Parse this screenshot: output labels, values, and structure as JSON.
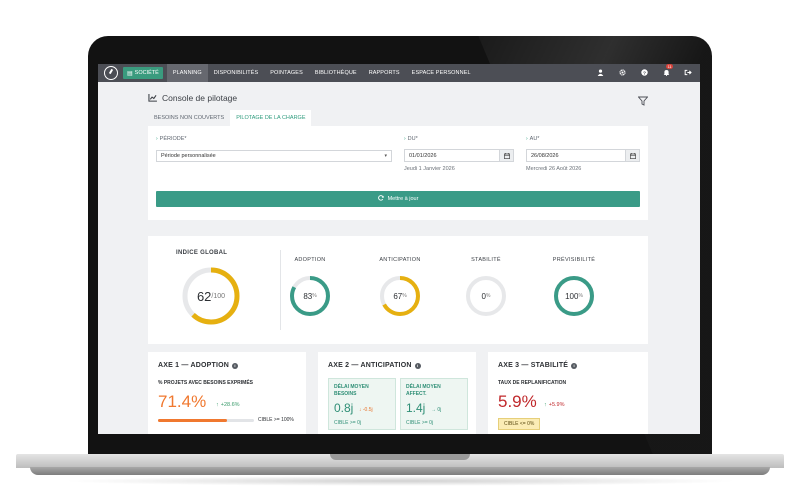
{
  "nav": {
    "societe": "SOCIÉTÉ",
    "items": [
      "PLANNING",
      "DISPONIBILITÉS",
      "POINTAGES",
      "BIBLIOTHÈQUE",
      "RAPPORTS",
      "ESPACE PERSONNEL"
    ],
    "active_index": 0,
    "notification_count": "11",
    "icons": [
      "user-icon",
      "gear-icon",
      "help-icon",
      "bell-icon",
      "logout-icon"
    ]
  },
  "page": {
    "title": "Console de pilotage",
    "title_icon": "chart-line-icon",
    "filter_icon": "filter-icon"
  },
  "tabs": [
    {
      "label": "BESOINS NON COUVERTS",
      "active": false
    },
    {
      "label": "PILOTAGE DE LA CHARGE",
      "active": true
    }
  ],
  "filters": {
    "periode_label": "PÉRIODE*",
    "periode_value": "Période personnalisée",
    "du_label": "DU*",
    "du_value": "01/01/2026",
    "du_hint": "Jeudi 1 Janvier 2026",
    "au_label": "AU*",
    "au_value": "26/08/2026",
    "au_hint": "Mercredi 26 Août 2026",
    "update_button": "Mettre à jour"
  },
  "kpis": {
    "global": {
      "label": "INDICE GLOBAL",
      "value": "62",
      "max": "/100",
      "ratio": 0.62,
      "color": "#e6b010"
    },
    "items": [
      {
        "label": "ADOPTION",
        "value": "83",
        "unit": "%",
        "ratio": 0.83,
        "color": "#3a9b87"
      },
      {
        "label": "ANTICIPATION",
        "value": "67",
        "unit": "%",
        "ratio": 0.67,
        "color": "#e6b010"
      },
      {
        "label": "STABILITÉ",
        "value": "0",
        "unit": "%",
        "ratio": 0.0,
        "color": "#3a9b87"
      },
      {
        "label": "PRÉVISIBILITÉ",
        "value": "100",
        "unit": "%",
        "ratio": 1.0,
        "color": "#3a9b87"
      }
    ]
  },
  "axes": {
    "adoption": {
      "title": "AXE 1 — ADOPTION",
      "subtitle": "% PROJETS AVEC BESOINS EXPRIMÉS",
      "value": "71.4%",
      "value_color": "#f0782f",
      "delta": "+28.6%",
      "progress": 0.714,
      "cible": "CIBLE >= 100%"
    },
    "anticipation": {
      "title": "AXE 2 — ANTICIPATION",
      "box1_label": "DÉLAI MOYEN BESOINS",
      "box1_value": "0.8j",
      "box1_delta": "-0.5j",
      "box1_cible": "CIBLE >= 0j",
      "box2_label": "DÉLAI MOYEN AFFECT.",
      "box2_value": "1.4j",
      "box2_delta": "0j",
      "box2_cible": "CIBLE >= 0j"
    },
    "stabilite": {
      "title": "AXE 3 — STABILITÉ",
      "subtitle": "TAUX DE REPLANIFICATION",
      "value": "5.9%",
      "value_color": "#c0282b",
      "delta": "+5.9%",
      "cible": "CIBLE <= 0%"
    }
  }
}
